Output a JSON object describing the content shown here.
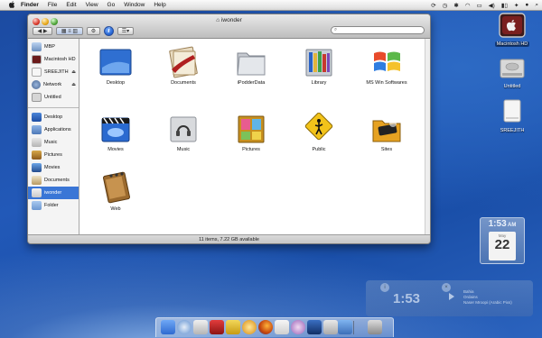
{
  "menubar": {
    "apple": "",
    "app": "Finder",
    "items": [
      "File",
      "Edit",
      "View",
      "Go",
      "Window",
      "Help"
    ]
  },
  "window": {
    "title": "iwonder",
    "search_placeholder": "",
    "status": "11 items, 7.22 GB available"
  },
  "sidebar": {
    "devices": [
      "MBP",
      "Macintosh HD",
      "SREEJITH",
      "Network",
      "Untitled"
    ],
    "places": [
      "Desktop",
      "Applications",
      "Music",
      "Pictures",
      "Movies",
      "Documents",
      "iwonder",
      "Folder"
    ],
    "selected": "iwonder"
  },
  "items": [
    "Desktop",
    "Documents",
    "iPodderData",
    "Library",
    "MS Win Softwares",
    "Movies",
    "Music",
    "Pictures",
    "Public",
    "Sites",
    "Web"
  ],
  "desktop": {
    "items": [
      "Macintosh HD",
      "Untitled",
      "SREEJITH"
    ]
  },
  "widgets": {
    "clock": {
      "time": "1:53",
      "ampm": "AM",
      "month": "May",
      "day": "22"
    },
    "dash_clock": "1:53",
    "itunes": [
      "Bahia",
      "Ordains",
      "Naser Mroopi (Arabic Pixs)"
    ]
  },
  "colors": {
    "selection": "#3a76d6",
    "desktop": "#2259b8"
  }
}
